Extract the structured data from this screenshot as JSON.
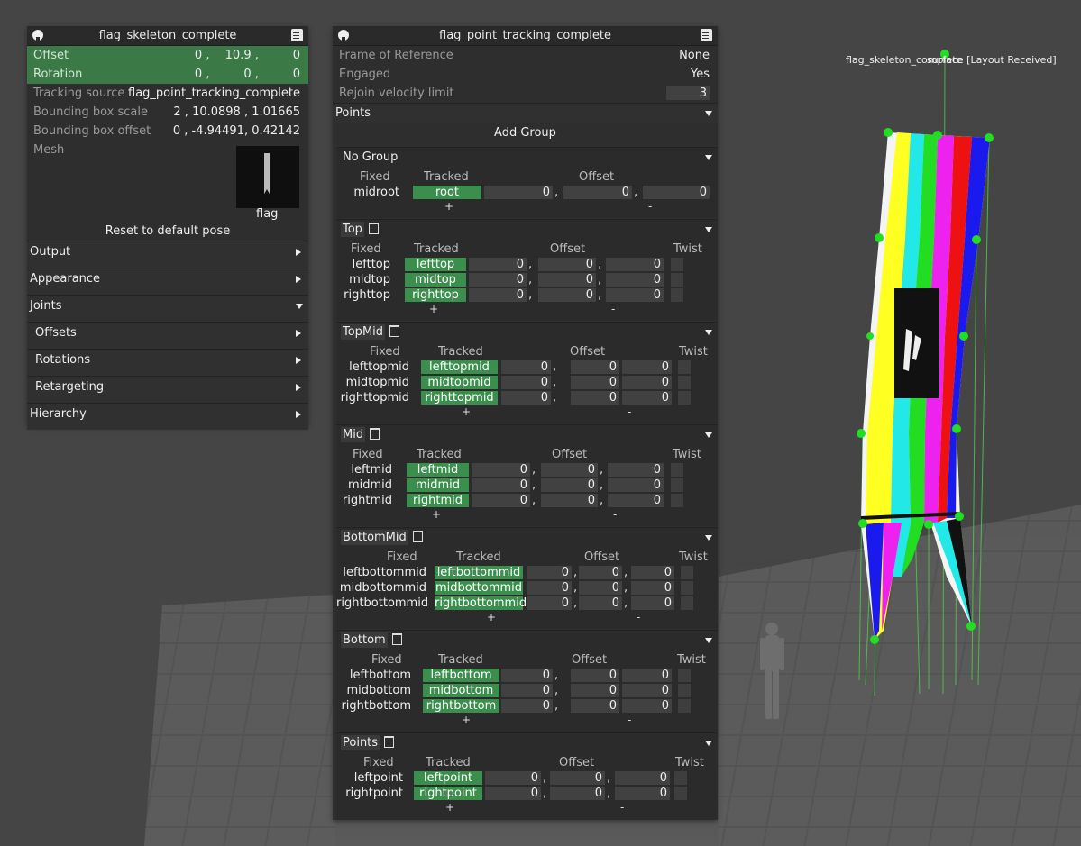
{
  "left_panel": {
    "title": "flag_skeleton_complete",
    "offset": {
      "label": "Offset",
      "x": "0",
      "y": "10.9",
      "z": "0"
    },
    "rotation": {
      "label": "Rotation",
      "x": "0",
      "y": "0",
      "z": "0"
    },
    "tracking_source": {
      "label": "Tracking source",
      "value": "flag_point_tracking_complete"
    },
    "bbox_scale": {
      "label": "Bounding box scale",
      "value": "2 , 10.0898 , 1.01665"
    },
    "bbox_offset": {
      "label": "Bounding box offset",
      "value": "0 , -4.94491, 0.42142"
    },
    "mesh": {
      "label": "Mesh",
      "name": "flag"
    },
    "reset_label": "Reset to default pose",
    "sections": {
      "output": "Output",
      "appearance": "Appearance",
      "joints": "Joints",
      "offsets": "Offsets",
      "rotations": "Rotations",
      "retargeting": "Retargeting",
      "hierarchy": "Hierarchy"
    }
  },
  "right_panel": {
    "title": "flag_point_tracking_complete",
    "frame_of_reference": {
      "label": "Frame of Reference",
      "value": "None"
    },
    "engaged": {
      "label": "Engaged",
      "value": "Yes"
    },
    "rejoin_velocity": {
      "label": "Rejoin velocity limit",
      "value": "3"
    },
    "points_label": "Points",
    "add_group": "Add Group",
    "headers": {
      "fixed": "Fixed",
      "tracked": "Tracked",
      "offset": "Offset",
      "twist": "Twist"
    },
    "plus": "+",
    "minus": "-",
    "groups": [
      {
        "name": "No Group",
        "twist": false,
        "rows": [
          {
            "fixed": "midroot",
            "tracked": "root",
            "o": [
              "0",
              "0",
              "0"
            ]
          }
        ]
      },
      {
        "name": "Top",
        "twist": true,
        "rows": [
          {
            "fixed": "lefttop",
            "tracked": "lefttop",
            "o": [
              "0",
              "0",
              "0"
            ]
          },
          {
            "fixed": "midtop",
            "tracked": "midtop",
            "o": [
              "0",
              "0",
              "0"
            ]
          },
          {
            "fixed": "righttop",
            "tracked": "righttop",
            "o": [
              "0",
              "0",
              "0"
            ]
          }
        ]
      },
      {
        "name": "TopMid",
        "twist": true,
        "rows": [
          {
            "fixed": "lefttopmid",
            "tracked": "lefttopmid",
            "o": [
              "0",
              "0",
              "0"
            ]
          },
          {
            "fixed": "midtopmid",
            "tracked": "midtopmid",
            "o": [
              "0",
              "0",
              "0"
            ]
          },
          {
            "fixed": "righttopmid",
            "tracked": "righttopmid",
            "o": [
              "0",
              "0",
              "0"
            ]
          }
        ]
      },
      {
        "name": "Mid",
        "twist": true,
        "rows": [
          {
            "fixed": "leftmid",
            "tracked": "leftmid",
            "o": [
              "0",
              "0",
              "0"
            ]
          },
          {
            "fixed": "midmid",
            "tracked": "midmid",
            "o": [
              "0",
              "0",
              "0"
            ]
          },
          {
            "fixed": "rightmid",
            "tracked": "rightmid",
            "o": [
              "0",
              "0",
              "0"
            ]
          }
        ]
      },
      {
        "name": "BottomMid",
        "twist": true,
        "rows": [
          {
            "fixed": "leftbottommid",
            "tracked": "leftbottommid",
            "o": [
              "0",
              "0",
              "0"
            ]
          },
          {
            "fixed": "midbottommid",
            "tracked": "midbottommid",
            "o": [
              "0",
              "0",
              "0"
            ]
          },
          {
            "fixed": "rightbottommid",
            "tracked": "rightbottommid",
            "o": [
              "0",
              "0",
              "0"
            ]
          }
        ]
      },
      {
        "name": "Bottom",
        "twist": true,
        "rows": [
          {
            "fixed": "leftbottom",
            "tracked": "leftbottom",
            "o": [
              "0",
              "0",
              "0"
            ]
          },
          {
            "fixed": "midbottom",
            "tracked": "midbottom",
            "o": [
              "0",
              "0",
              "0"
            ]
          },
          {
            "fixed": "rightbottom",
            "tracked": "rightbottom",
            "o": [
              "0",
              "0",
              "0"
            ]
          }
        ]
      },
      {
        "name": "Points",
        "twist": true,
        "rows": [
          {
            "fixed": "leftpoint",
            "tracked": "leftpoint",
            "o": [
              "0",
              "0",
              "0"
            ]
          },
          {
            "fixed": "rightpoint",
            "tracked": "rightpoint",
            "o": [
              "0",
              "0",
              "0"
            ]
          }
        ]
      }
    ]
  },
  "viewport": {
    "label_a": "flag_skeleton_complete",
    "label_b": "surface [Layout Received]"
  },
  "colors": {
    "accent_green": "#3b7a47",
    "tracked_green": "#3b8f4d",
    "panel_bg": "#2e2e2e",
    "joint_green": "#22dd22"
  }
}
